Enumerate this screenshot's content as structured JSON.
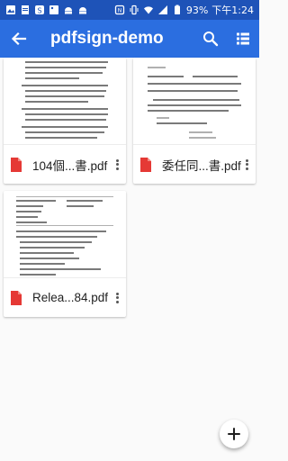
{
  "status": {
    "battery": "93%",
    "time": "下午1:24"
  },
  "appbar": {
    "title": "pdfsign-demo"
  },
  "files": [
    {
      "name": "104個...書.pdf"
    },
    {
      "name": "委任同...書.pdf"
    },
    {
      "name": "Relea...84.pdf"
    }
  ],
  "colors": {
    "statusbar": "#1e53b8",
    "appbar": "#2b6ee0",
    "pdf_icon": "#e53935"
  },
  "icons": [
    "back-arrow-icon",
    "search-icon",
    "list-view-icon",
    "more-vert-icon",
    "add-icon",
    "pdf-file-icon"
  ]
}
